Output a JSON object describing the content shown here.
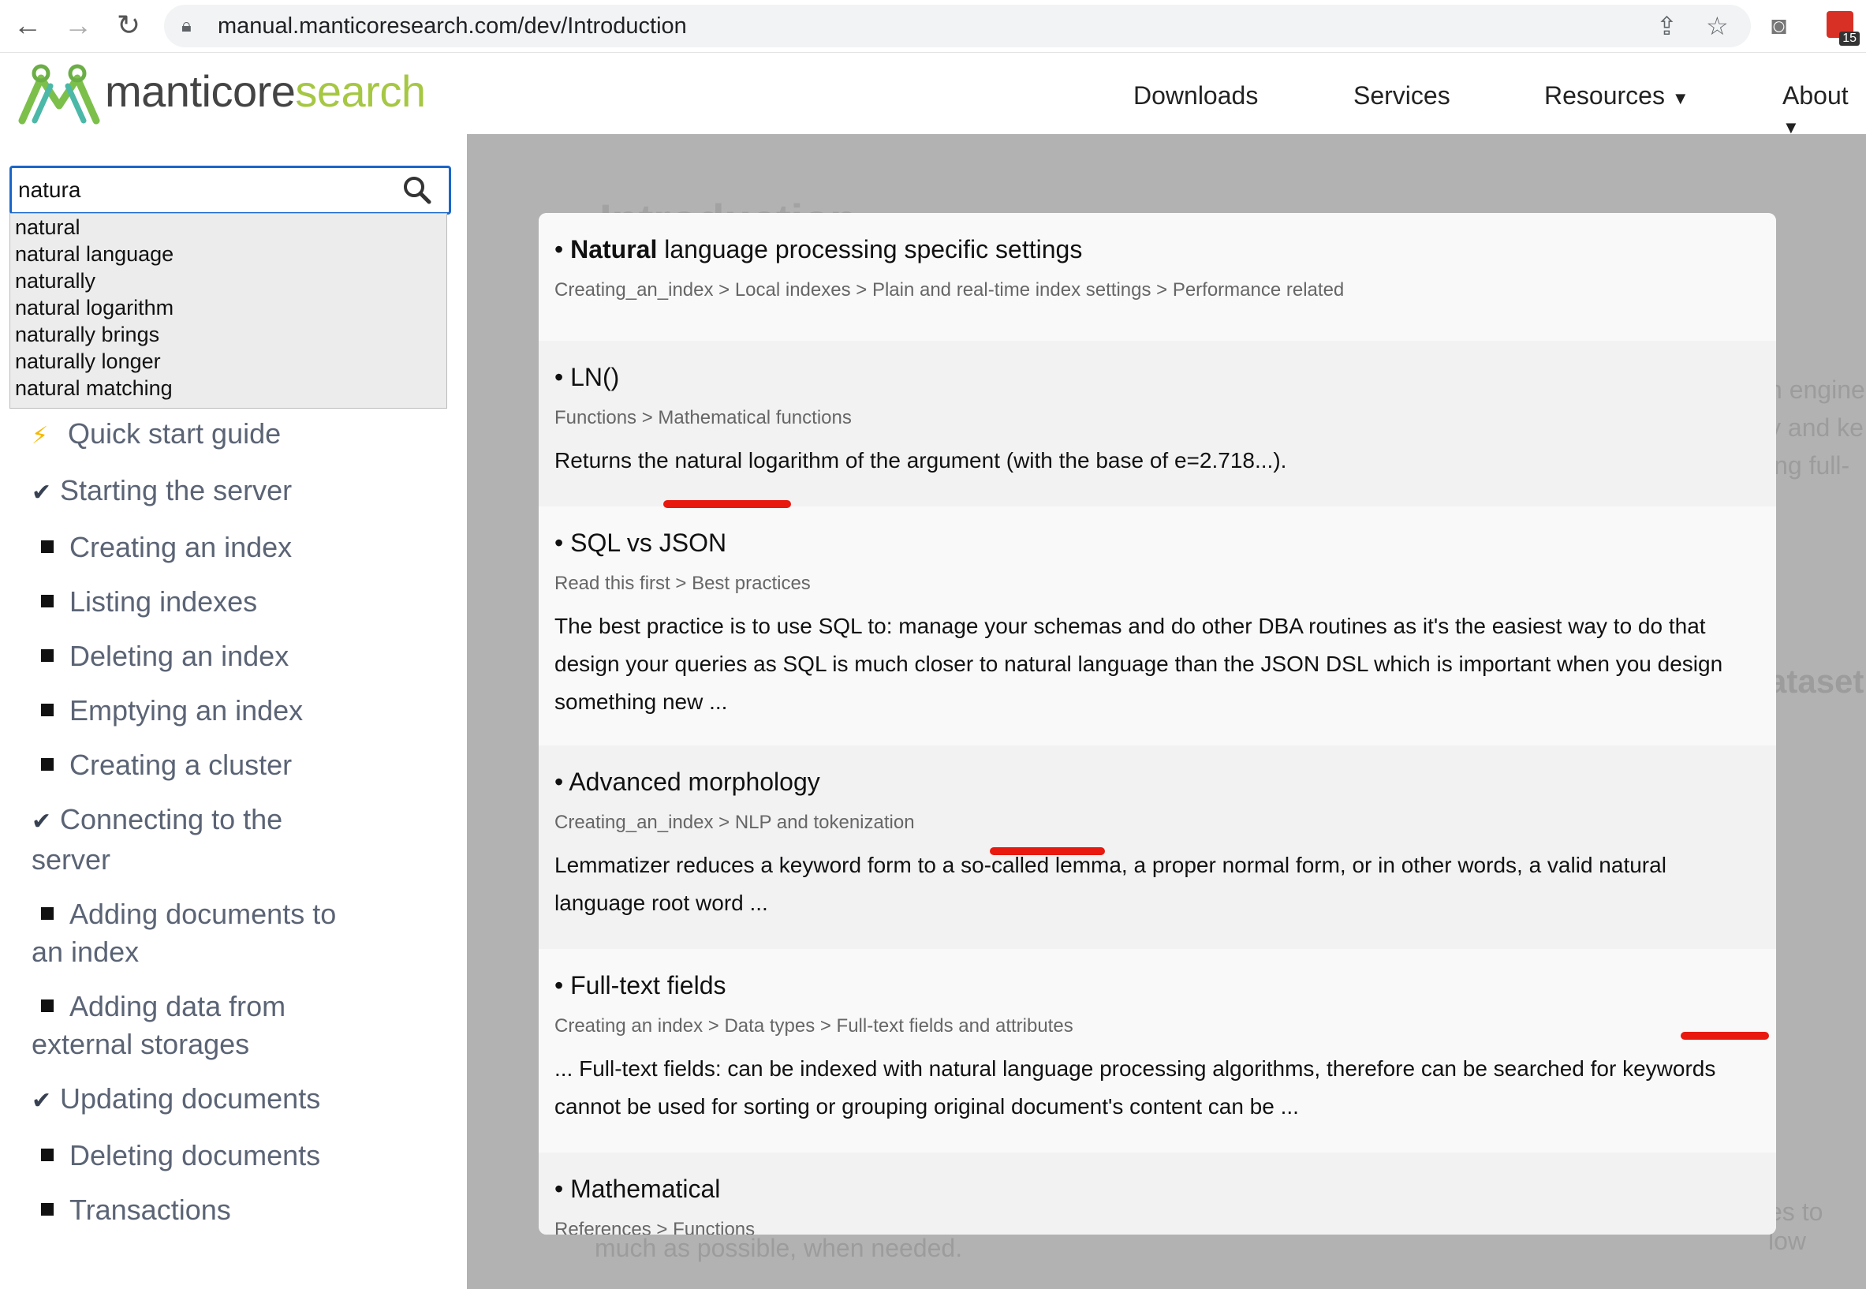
{
  "browser": {
    "url": "manual.manticoresearch.com/dev/Introduction",
    "extension_badge": "15"
  },
  "site": {
    "logo_part1": "manticore",
    "logo_part2": "search",
    "nav": [
      "Downloads",
      "Services",
      "Resources",
      "About"
    ]
  },
  "sidebar": {
    "search_value": "natura",
    "suggestions": [
      "natural",
      "natural language",
      "naturally",
      "natural logarithm",
      "naturally brings",
      "naturally longer",
      "natural matching"
    ],
    "menu": [
      {
        "icon": "bolt",
        "label": "Quick start guide"
      },
      {
        "icon": "check",
        "label": "Starting the server"
      },
      {
        "icon": "square",
        "label": "Creating an index"
      },
      {
        "icon": "square",
        "label": "Listing indexes"
      },
      {
        "icon": "square",
        "label": "Deleting an index"
      },
      {
        "icon": "square",
        "label": "Emptying an index"
      },
      {
        "icon": "square",
        "label": "Creating a cluster"
      },
      {
        "icon": "check",
        "label": "Connecting to the",
        "label2": "server"
      },
      {
        "icon": "square",
        "label": "Adding documents to",
        "label2": "an index"
      },
      {
        "icon": "square",
        "label": "Adding data from",
        "label2": "external storages"
      },
      {
        "icon": "check",
        "label": "Updating documents"
      },
      {
        "icon": "square",
        "label": "Deleting documents"
      },
      {
        "icon": "square",
        "label": "Transactions"
      }
    ]
  },
  "background_page": {
    "heading_fragment": "Introduction",
    "right_lines": [
      "h engine",
      "y and ke",
      "ing full-",
      "ataset",
      "es to low"
    ],
    "bottom_line": "much as possible, when needed."
  },
  "results": [
    {
      "bullet": "•",
      "title_bold": "Natural",
      "title_rest": " language processing specific settings",
      "crumb": "Creating_an_index > Local indexes > Plain and real-time index settings > Performance related",
      "text": ""
    },
    {
      "bullet": "•",
      "title_bold": "",
      "title_rest": "LN()",
      "crumb": "Functions > Mathematical functions",
      "text": "Returns the natural logarithm of the argument (with the base of e=2.718...)."
    },
    {
      "bullet": "•",
      "title_bold": "",
      "title_rest": "SQL vs JSON",
      "crumb": "Read this first > Best practices",
      "text": "The best practice is to use SQL to: manage your schemas and do other DBA routines as it's the easiest way to do that design your queries as SQL is much closer to natural language than the JSON DSL which is important when you design something new ..."
    },
    {
      "bullet": "•",
      "title_bold": "",
      "title_rest": "Advanced morphology",
      "crumb": "Creating_an_index > NLP and tokenization",
      "text": "Lemmatizer reduces a keyword form to a so-called lemma, a proper normal form, or in other words, a valid natural language root word ..."
    },
    {
      "bullet": "•",
      "title_bold": "",
      "title_rest": "Full-text fields",
      "crumb": "Creating an index > Data types > Full-text fields and attributes",
      "text": "... Full-text fields: can be indexed with natural language processing algorithms, therefore can be searched for keywords cannot be used for sorting or grouping original document's content can be ..."
    },
    {
      "bullet": "•",
      "title_bold": "",
      "title_rest": "Mathematical",
      "crumb": "References > Functions",
      "text": ""
    }
  ],
  "colors": {
    "accent": "#1a66c9",
    "brand_green": "#a6c744",
    "annotation_red": "#e8190f"
  }
}
